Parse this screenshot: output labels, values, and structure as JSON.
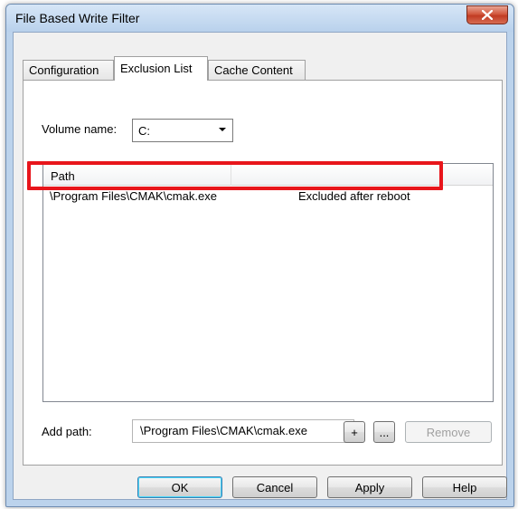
{
  "window": {
    "title": "File Based Write Filter"
  },
  "tabs": [
    {
      "label": "Configuration",
      "active": false
    },
    {
      "label": "Exclusion List",
      "active": true
    },
    {
      "label": "Cache Content",
      "active": false
    }
  ],
  "volume": {
    "label": "Volume name:",
    "selected": "C:"
  },
  "list": {
    "columns": [
      "Path",
      ""
    ],
    "rows": [
      {
        "path": "\\Program Files\\CMAK\\cmak.exe",
        "status": "Excluded after reboot"
      }
    ]
  },
  "add_path": {
    "label": "Add path:",
    "value": "\\Program Files\\CMAK\\cmak.exe",
    "add_button": "+",
    "browse_button": "...",
    "remove_button": "Remove"
  },
  "buttons": {
    "ok": "OK",
    "cancel": "Cancel",
    "apply": "Apply",
    "help": "Help"
  },
  "colors": {
    "highlight": "#e8151b",
    "close": "#c13b23"
  },
  "icons": {
    "close": "close-icon",
    "dropdown": "chevron-down-icon"
  }
}
